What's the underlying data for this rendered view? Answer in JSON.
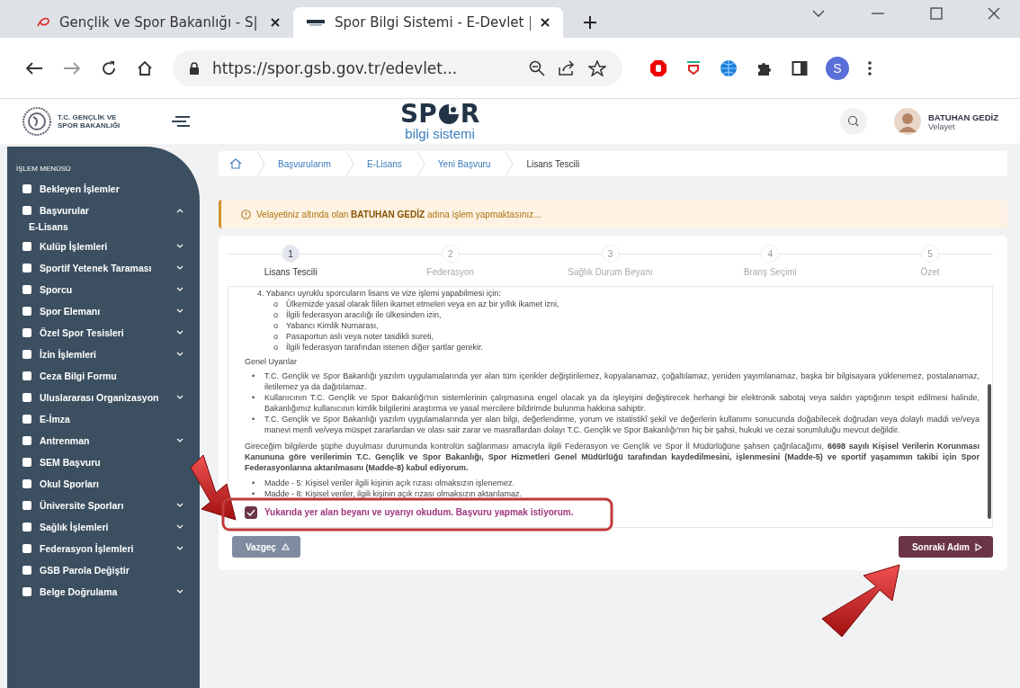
{
  "browser": {
    "tabs": [
      {
        "title": "Gençlik ve Spor Bakanlığı - S|",
        "selected": false
      },
      {
        "title": "Spor Bilgi Sistemi - E-Devlet |",
        "selected": true
      }
    ],
    "address": "https://spor.gsb.gov.tr/edevlet...",
    "profile": "S"
  },
  "header": {
    "ministry": [
      "T.C. GENÇLİK VE",
      "SPOR BAKANLIĞI"
    ],
    "brand_start": "SP",
    "brand_end": "R",
    "subtitle": "bilgi sistemi",
    "user_name": "BATUHAN GEDİZ",
    "user_role": "Velayet"
  },
  "sidebar": {
    "heading": "İŞLEM MENÜSÜ",
    "items": [
      {
        "label": "Bekleyen İşlemler",
        "kind": "link"
      },
      {
        "label": "Başvurular",
        "kind": "group",
        "expanded": true,
        "children": [
          {
            "label": "E-Lisans",
            "kind": "link"
          }
        ]
      },
      {
        "label": "Kulüp İşlemleri",
        "kind": "group",
        "expanded": false
      },
      {
        "label": "Sportif Yetenek Taraması",
        "kind": "group",
        "expanded": false
      },
      {
        "label": "Sporcu",
        "kind": "group",
        "expanded": false
      },
      {
        "label": "Spor Elemanı",
        "kind": "group",
        "expanded": false
      },
      {
        "label": "Özel Spor Tesisleri",
        "kind": "group",
        "expanded": false
      },
      {
        "label": "İzin İşlemleri",
        "kind": "group",
        "expanded": false
      },
      {
        "label": "Ceza Bilgi Formu",
        "kind": "link"
      },
      {
        "label": "Uluslararası Organizasyon",
        "kind": "group",
        "expanded": false
      },
      {
        "label": "E-İmza",
        "kind": "link"
      },
      {
        "label": "Antrenman",
        "kind": "group",
        "expanded": false
      },
      {
        "label": "SEM Başvuru",
        "kind": "link"
      },
      {
        "label": "Okul Sporları",
        "kind": "link"
      },
      {
        "label": "Üniversite Sporları",
        "kind": "group",
        "expanded": false
      },
      {
        "label": "Sağlık İşlemleri",
        "kind": "group",
        "expanded": false
      },
      {
        "label": "Federasyon İşlemleri",
        "kind": "group",
        "expanded": false
      },
      {
        "label": "GSB Parola Değiştir",
        "kind": "link"
      },
      {
        "label": "Belge Doğrulama",
        "kind": "group",
        "expanded": false
      }
    ]
  },
  "breadcrumb": [
    {
      "label": "Başvurularım",
      "current": false
    },
    {
      "label": "E-Lisans",
      "current": false
    },
    {
      "label": "Yeni Başvuru",
      "current": false
    },
    {
      "label": "Lisans Tescili",
      "current": true
    }
  ],
  "alert": "Velayetiniz altında olan **BATUHAN GEDİZ** adına işlem yapmaktasınız...",
  "steps": [
    {
      "number": "1",
      "label": "Lisans Tescili",
      "selected": true
    },
    {
      "number": "2",
      "label": "Federasyon",
      "selected": false
    },
    {
      "number": "3",
      "label": "Sağlık Durum Beyanı",
      "selected": false
    },
    {
      "number": "4",
      "label": "Branş Seçimi",
      "selected": false
    },
    {
      "number": "5",
      "label": "Özet",
      "selected": false
    }
  ],
  "terms": {
    "numbered_item": "4. Yabancı uyruklu sporcuların lisans ve vize işlemi yapabilmesi için:",
    "sub_items": [
      {
        "marker": "o",
        "text": "Ülkemizde yasal olarak fiilen ikamet etmeleri veya en az bir yıllık ikamet izni,"
      },
      {
        "marker": "o",
        "text": "İlgili federasyon aracılığı ile ülkesinden izin,"
      },
      {
        "marker": "o",
        "text": "Yabancı Kimlik Numarası,"
      },
      {
        "marker": "o",
        "text": "Pasaportun aslı veya noter tasdikli sureti,"
      },
      {
        "marker": "o",
        "text": "İlgili federasyon tarafından istenen diğer şartlar gerekir."
      }
    ],
    "heading": "Genel Uyarılar",
    "warnings": [
      {
        "marker": "•",
        "text": "T.C. Gençlik ve Spor Bakanlığı yazılım uygulamalarında yer alan tüm içerikler değiştirilemez, kopyalanamaz, çoğaltılamaz, yeniden yayımlanamaz, başka bir bilgisayara yüklenemez, postalanamaz, iletilemez ya da dağıtılamaz."
      },
      {
        "marker": "•",
        "text": "Kullanıcının T.C. Gençlik ve Spor Bakanlığı'nın sistemlerinin çalışmasına engel olacak ya da işleyişini değiştirecek herhangi bir elektronik sabotaj veya saldırı yaptığının tespit edilmesi halinde, Bakanlığımız kullanıcının kimlik bilgilerini araştırma ve yasal mercilere bildirimde bulunma hakkına sahiptir."
      },
      {
        "marker": "•",
        "text": "T.C. Gençlik ve Spor Bakanlığı yazılım uygulamalarında yer alan bilgi, değerlendirme, yorum ve istatistikî şekil ve değerlerin kullanımı sonucunda doğabilecek doğrudan veya dolaylı maddi ve/veya manevi menfi ve/veya müspet zararlardan ve olası sair zarar ve masraflardan dolayı T.C. Gençlik ve Spor Bakanlığı'nın hiç bir şahsi, hukuki ve cezai sorumluluğu mevcut değildir."
      }
    ],
    "declaration": "Gireceğim bilgilerde şüphe duyulması durumunda kontrolün sağlanması amacıyla ilgili Federasyon ve Gençlik ve Spor İl Müdürlüğüne şahsen çağrılacağımı, **6698 sayılı Kişisel Verilerin Korunması Kanununa göre verilerimin T.C. Gençlik ve Spor Bakanlığı, Spor Hizmetleri Genel Müdürlüğü tarafından kaydedilmesini, işlenmesini (Madde-5) ve sportif yaşamımın takibi için Spor Federasyonlarına aktarılmasını (Madde-8) kabul ediyorum.**",
    "articles": [
      {
        "marker": "•",
        "text": "Madde - 5: Kişisel veriler ilgili kişinin açık rızası olmaksızın işlenemez."
      },
      {
        "marker": "•",
        "text": "Madde - 8: Kişisel veriler, ilgili kişinin açık rızası olmaksızın aktarılamaz."
      }
    ]
  },
  "consent": {
    "label": "Yukarıda yer alan beyanı ve uyarıyı okudum. Başvuru yapmak istiyorum.",
    "checked": true
  },
  "buttons": {
    "cancel": "Vazgeç",
    "next": "Sonraki Adım"
  }
}
